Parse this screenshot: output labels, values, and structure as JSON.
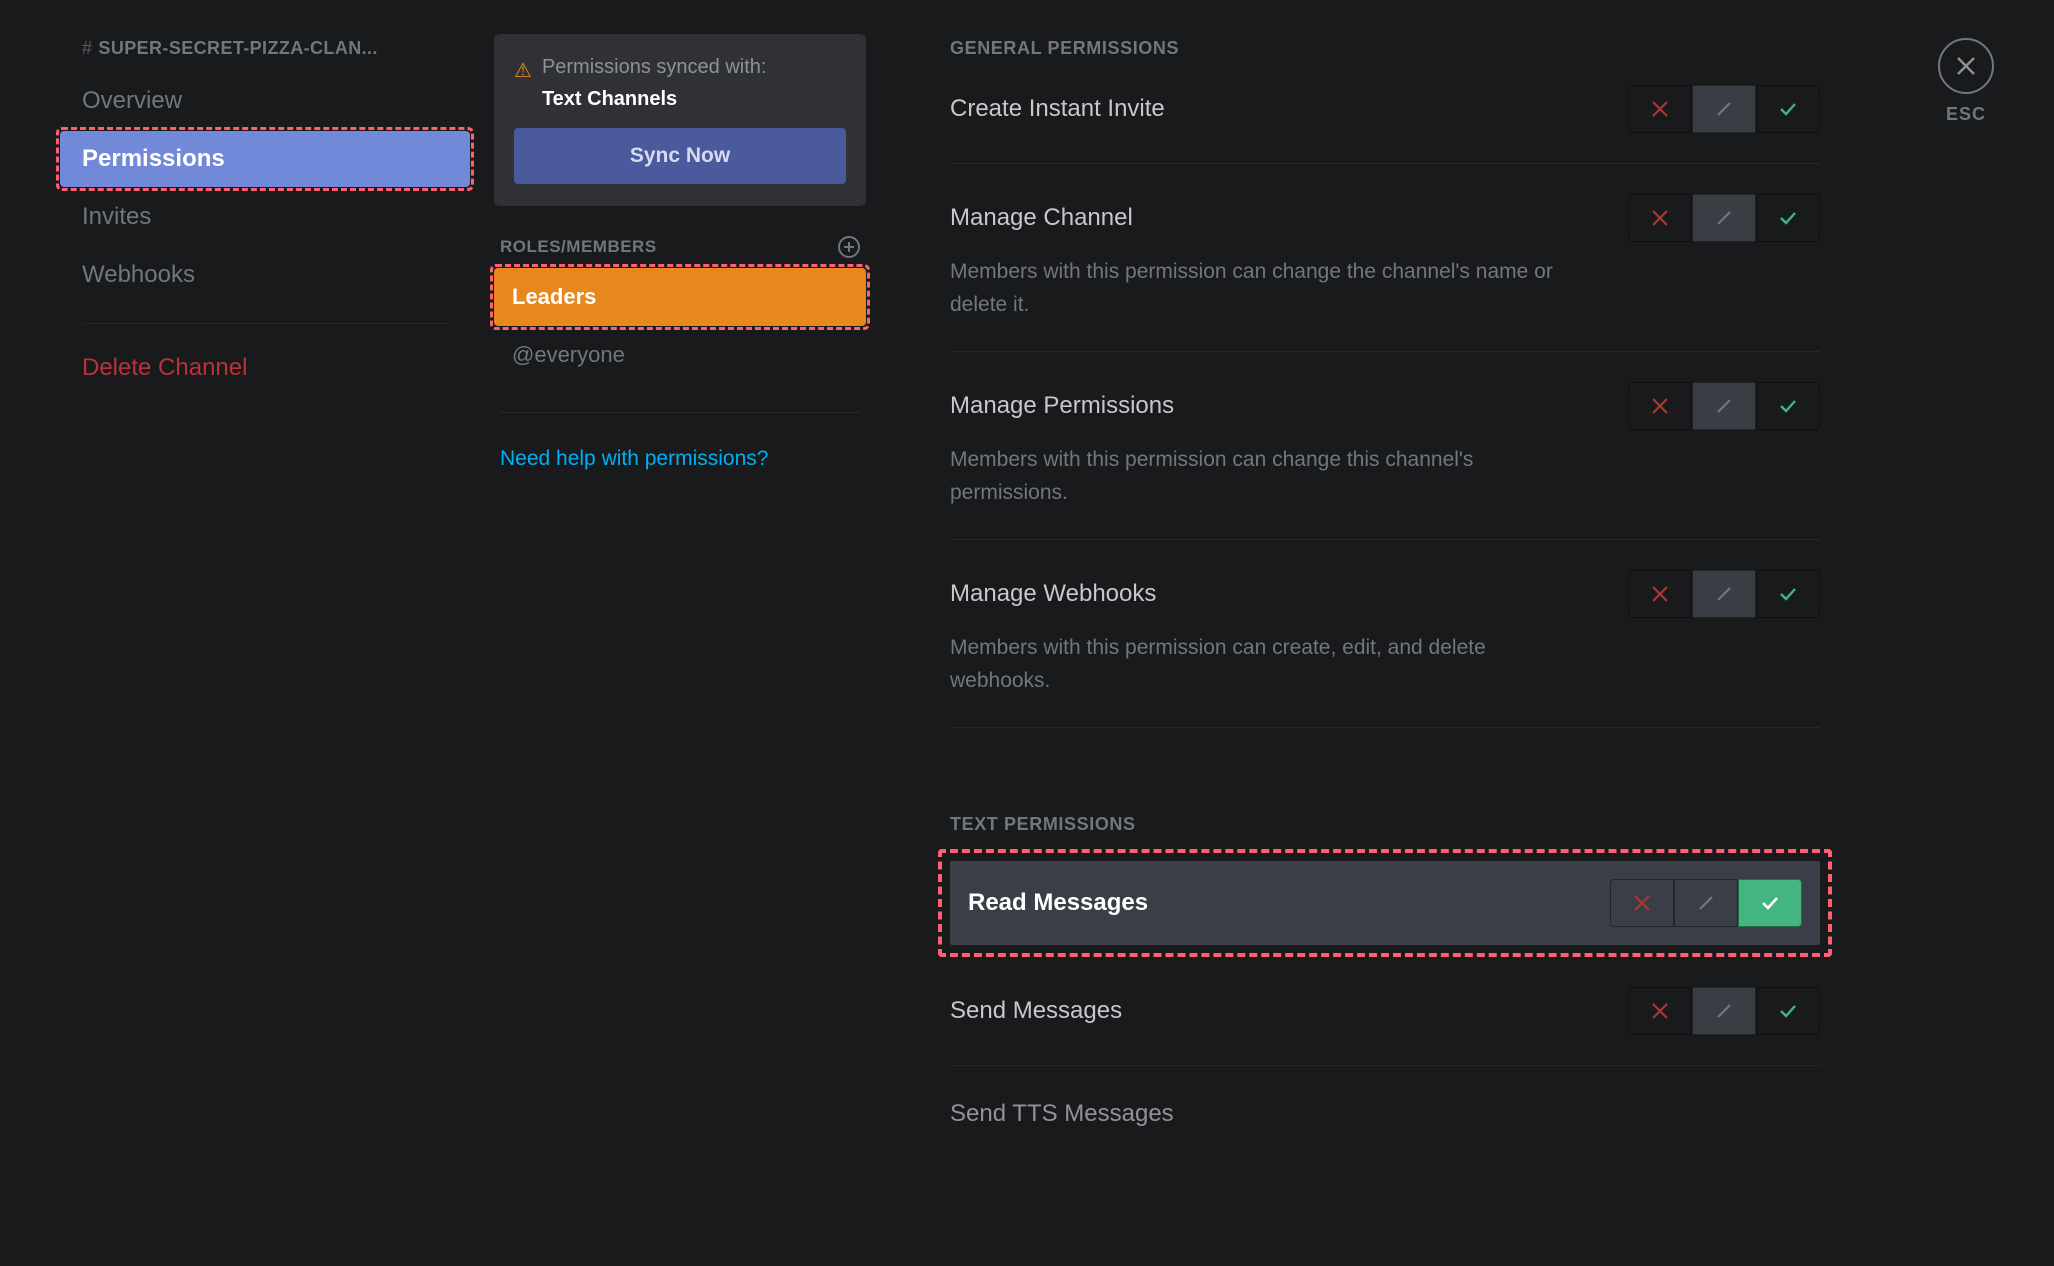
{
  "sidebar": {
    "channel_label": "SUPER-SECRET-PIZZA-CLAN...",
    "items": {
      "overview": "Overview",
      "permissions": "Permissions",
      "invites": "Invites",
      "webhooks": "Webhooks"
    },
    "delete_label": "Delete Channel"
  },
  "sync": {
    "line1": "Permissions synced with:",
    "line2": "Text Channels",
    "button": "Sync Now"
  },
  "roles": {
    "header": "ROLES/MEMBERS",
    "items": {
      "leaders": "Leaders",
      "everyone": "@everyone"
    },
    "help_link": "Need help with permissions?"
  },
  "perm_sections": {
    "general": "GENERAL PERMISSIONS",
    "text": "TEXT PERMISSIONS"
  },
  "perms": {
    "create_invite": {
      "name": "Create Instant Invite"
    },
    "manage_channel": {
      "name": "Manage Channel",
      "desc": "Members with this permission can change the channel's name or delete it."
    },
    "manage_permissions": {
      "name": "Manage Permissions",
      "desc": "Members with this permission can change this channel's permissions."
    },
    "manage_webhooks": {
      "name": "Manage Webhooks",
      "desc": "Members with this permission can create, edit, and delete webhooks."
    },
    "read_messages": {
      "name": "Read Messages"
    },
    "send_messages": {
      "name": "Send Messages"
    },
    "send_tts": {
      "name": "Send TTS Messages"
    }
  },
  "close": {
    "label": "ESC"
  }
}
